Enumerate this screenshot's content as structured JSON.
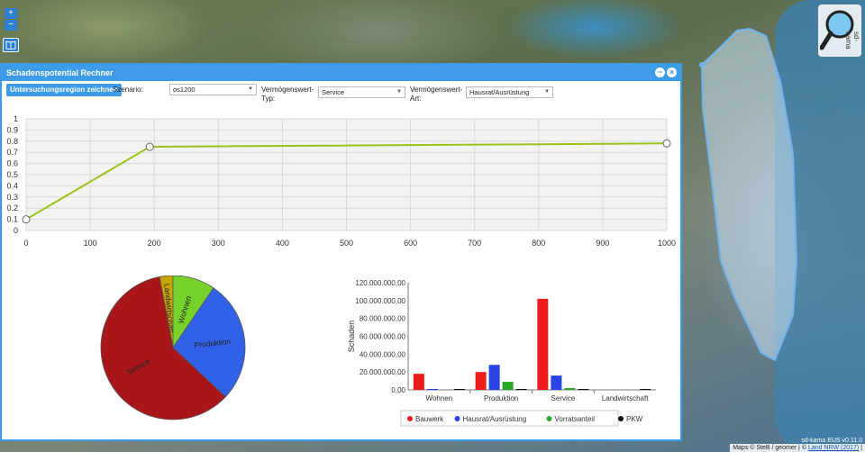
{
  "map": {
    "zoom_in": "+",
    "zoom_out": "−",
    "logo_label": "sd-kama",
    "version": "sd-kama EUS v0.11.0",
    "attribution_prefix": "Maps  © SteB / geomer | © ",
    "attribution_link": "Land NRW (2017)",
    "attribution_suffix": " |"
  },
  "panel": {
    "title": "Schadenspotential Rechner",
    "minimize": "−",
    "close": "×",
    "toolbar": {
      "region_button": "Untersuchungsregion zeichnen",
      "scenario_label": "Szenario:",
      "scenario_value": "os1200",
      "asset_type_label_1": "Vermögenswert-",
      "asset_type_label_2": "Typ:",
      "asset_type_value": "Service",
      "asset_kind_label_1": "Vermögenswert-",
      "asset_kind_label_2": "Art:",
      "asset_kind_value": "Hausrat/Ausrüstung"
    }
  },
  "chart_data": [
    {
      "type": "line",
      "x": [
        0,
        193,
        1000
      ],
      "y": [
        0.1,
        0.75,
        0.78
      ],
      "xlim": [
        0,
        1000
      ],
      "ylim": [
        0,
        1
      ],
      "xticks": [
        "0",
        "100",
        "200",
        "300",
        "400",
        "500",
        "600",
        "700",
        "800",
        "900",
        "1000"
      ],
      "yticks": [
        "0",
        "0.1",
        "0.2",
        "0.3",
        "0.4",
        "0.5",
        "0.6",
        "0.7",
        "0.8",
        "0.9",
        "1"
      ],
      "grid": true,
      "color": "#9ac31c"
    },
    {
      "type": "pie",
      "labels": [
        "Service",
        "Produktion",
        "Wohnen",
        "Landwirtschaft"
      ],
      "values": [
        60.0,
        27.5,
        9.5,
        3.0
      ],
      "colors": [
        "#a8161a",
        "#2f62e8",
        "#76d12a",
        "#c8a400"
      ]
    },
    {
      "type": "bar",
      "categories": [
        "Wohnen",
        "Produktion",
        "Service",
        "Landwirtschaft"
      ],
      "series": [
        {
          "name": "Bauwerk",
          "color": "#ee1b1b",
          "values": [
            18000000,
            20000000,
            102000000,
            0
          ]
        },
        {
          "name": "Hausrat/Ausrüstung",
          "color": "#2a43e6",
          "values": [
            1000000,
            28000000,
            16000000,
            0
          ]
        },
        {
          "name": "Vorratsanteil",
          "color": "#2aa82a",
          "values": [
            0,
            9000000,
            2000000,
            0
          ]
        },
        {
          "name": "PKW",
          "color": "#111111",
          "values": [
            0,
            0,
            0,
            0
          ]
        }
      ],
      "ylabel": "Schaden",
      "ylim": [
        0,
        120000000
      ],
      "yticks": [
        "0,00",
        "20.000.000,00",
        "40.000.000,00",
        "60.000.000,00",
        "80.000.000,00",
        "100.000.000,00",
        "120.000.000,00"
      ]
    }
  ]
}
